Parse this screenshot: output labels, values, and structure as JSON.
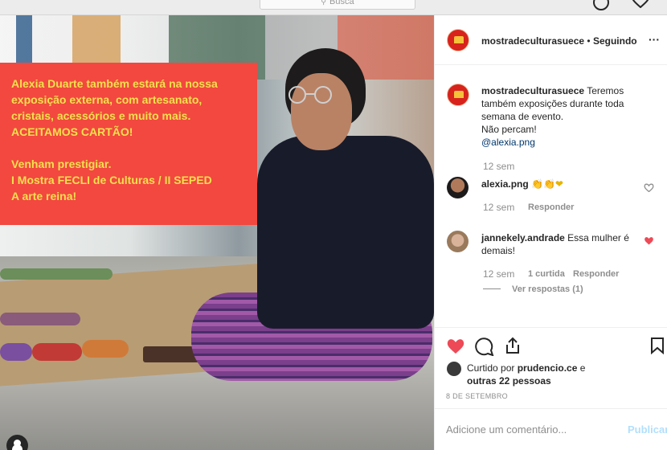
{
  "search": {
    "placeholder": "Busca"
  },
  "post": {
    "overlay_text": "Alexia Duarte também estará na nossa\nexposição externa, com artesanato,\ncristais, acessórios e muito mais.\nACEITAMOS CARTÃO!\n\nVenham prestigiar.\nI Mostra FECLI de Culturas / II SEPED\nA arte reina!"
  },
  "header": {
    "username": "mostradeculturasuece",
    "separator": "•",
    "follow_status": "Seguindo",
    "more": "···"
  },
  "caption": {
    "username": "mostradeculturasuece",
    "line1": "Teremos",
    "line2": "também exposições durante toda",
    "line3": "semana de evento.",
    "line4": "Não percam!",
    "mention": "@alexia.png",
    "time": "12 sem"
  },
  "comments": [
    {
      "username": "alexia.png",
      "text": "👏👏❤",
      "time": "12 sem",
      "reply": "Responder"
    },
    {
      "username": "jannekely.andrade",
      "text": "Essa mulher é",
      "text2": "demais!",
      "time": "12 sem",
      "likes": "1 curtida",
      "reply": "Responder",
      "view_replies": "Ver respostas (1)"
    }
  ],
  "likes": {
    "prefix": "Curtido por",
    "user": "prudencio.ce",
    "suffix": "e",
    "others": "outras 22 pessoas"
  },
  "date": "8 DE SETEMBRO",
  "comment_input": {
    "placeholder": "Adicione um comentário...",
    "publish": "Publicar"
  },
  "colors": {
    "accent": "#ed4956",
    "overlay_bg": "#f2483f",
    "overlay_text": "#f4e04d",
    "link": "#00376b",
    "publish": "#b2dffc"
  },
  "icons": [
    "search-icon",
    "explore-icon",
    "heart-icon",
    "comment-icon",
    "share-icon",
    "save-icon",
    "more-icon"
  ]
}
